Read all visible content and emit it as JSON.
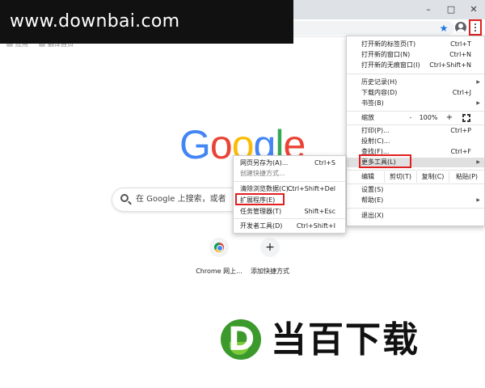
{
  "browser": {
    "window_controls": {
      "minimize": "–",
      "maximize": "□",
      "close": "✕"
    },
    "toolbar": {
      "star_icon": "star-icon",
      "account_icon": "account-icon",
      "menu_icon": "three-dot-menu-icon"
    },
    "bookmarks": [
      "应用",
      "翻译首页"
    ]
  },
  "watermark_top": "www.downbai.com",
  "new_tab_page": {
    "logo": [
      "G",
      "o",
      "o",
      "g",
      "l",
      "e"
    ],
    "logo_colors": [
      "#4285f4",
      "#ea4335",
      "#fbbc05",
      "#4285f4",
      "#34a853",
      "#ea4335"
    ],
    "search_placeholder": "在 Google 上搜索，或者输入网址",
    "shortcuts": [
      {
        "label": "Chrome 网上...",
        "icon": "chrome-icon"
      },
      {
        "label": "添加快捷方式",
        "icon": "+"
      }
    ]
  },
  "main_menu": {
    "items": [
      {
        "label": "打开新的标签页(T)",
        "shortcut": "Ctrl+T"
      },
      {
        "label": "打开新的窗口(N)",
        "shortcut": "Ctrl+N"
      },
      {
        "label": "打开新的无痕窗口(I)",
        "shortcut": "Ctrl+Shift+N"
      },
      {
        "label": "历史记录(H)",
        "shortcut": ""
      },
      {
        "label": "下载内容(D)",
        "shortcut": "Ctrl+J"
      },
      {
        "label": "书签(B)",
        "shortcut": ""
      },
      {
        "label": "打印(P)...",
        "shortcut": "Ctrl+P"
      },
      {
        "label": "投射(C)...",
        "shortcut": ""
      },
      {
        "label": "查找(F)...",
        "shortcut": "Ctrl+F"
      },
      {
        "label": "更多工具(L)",
        "shortcut": ""
      },
      {
        "label": "设置(S)",
        "shortcut": ""
      },
      {
        "label": "帮助(E)",
        "shortcut": ""
      },
      {
        "label": "退出(X)",
        "shortcut": ""
      }
    ],
    "zoom": {
      "label": "缩放",
      "minus": "-",
      "value": "100%",
      "plus": "+"
    },
    "edit": {
      "label": "编辑",
      "cut": "剪切(T)",
      "copy": "复制(C)",
      "paste": "粘贴(P)"
    }
  },
  "sub_menu": {
    "items": [
      {
        "label": "网页另存为(A)...",
        "shortcut": "Ctrl+S"
      },
      {
        "label": "创建快捷方式...",
        "shortcut": ""
      },
      {
        "label": "清除浏览数据(C)...",
        "shortcut": "Ctrl+Shift+Del"
      },
      {
        "label": "扩展程序(E)",
        "shortcut": ""
      },
      {
        "label": "任务管理器(T)",
        "shortcut": "Shift+Esc"
      },
      {
        "label": "开发者工具(D)",
        "shortcut": "Ctrl+Shift+I"
      }
    ]
  },
  "watermark_bottom": {
    "letter": "D",
    "text": "当百下载"
  }
}
